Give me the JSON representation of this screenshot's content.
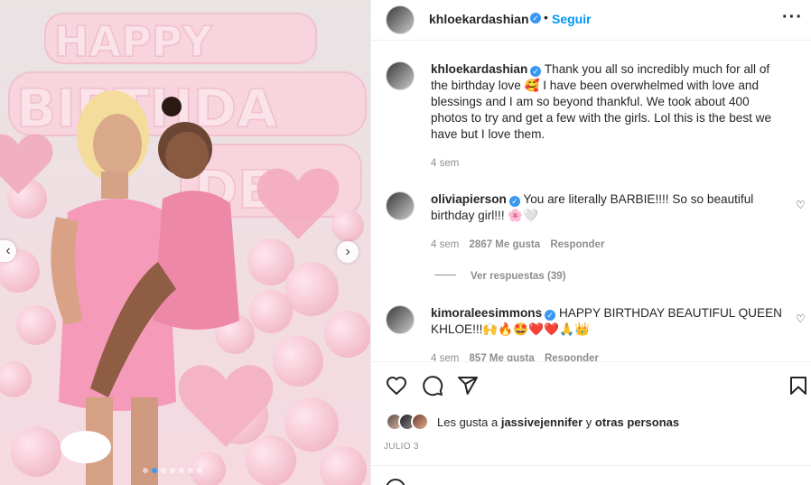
{
  "post": {
    "username": "khloekardashian",
    "separator": "•",
    "follow_label": "Seguir",
    "more_label": "···",
    "verified_mark": "✓"
  },
  "carousel": {
    "prev_label": "‹",
    "next_label": "›",
    "slide_count": 7,
    "active_slide": 2
  },
  "caption": {
    "username": "khloekardashian",
    "text_line1": "Thank you all so incredibly much for all of",
    "text_line2": "the birthday love 🥰 I have been overwhelmed with love and",
    "text_line3": "blessings and I am so beyond thankful. We took about 400",
    "text_line4": "photos to try and get a few with the girls. Lol this is the best we",
    "text_line5": "have but I love them.",
    "time": "4 sem"
  },
  "comments": [
    {
      "username": "oliviapierson",
      "text_line1": "You are literally BARBIE!!!! So so beautiful",
      "text_line2": "birthday girl!!! 🌸🤍",
      "time": "4 sem",
      "likes": "2867 Me gusta",
      "reply_label": "Responder",
      "view_replies": "Ver respuestas (39)"
    },
    {
      "username": "kimoraleesimmons",
      "text_line1": "HAPPY BIRTHDAY BEAUTIFUL QUEEN",
      "text_line2": "KHLOE!!!🙌🔥🤩❤️❤️🙏👑",
      "time": "4 sem",
      "likes": "857 Me gusta",
      "reply_label": "Responder"
    }
  ],
  "actions": {
    "heart_icon": "heart-icon",
    "comment_icon": "comment-icon",
    "share_icon": "share-icon",
    "save_icon": "bookmark-icon"
  },
  "likes": {
    "prefix": "Les gusta a",
    "user": "jassivejennifer",
    "connector": "y",
    "others": "otras personas"
  },
  "date": "JULIO 3",
  "colors": {
    "link_blue": "#0095f6",
    "verified_blue": "#3897f0",
    "muted": "#8e8e8e",
    "text": "#262626"
  }
}
